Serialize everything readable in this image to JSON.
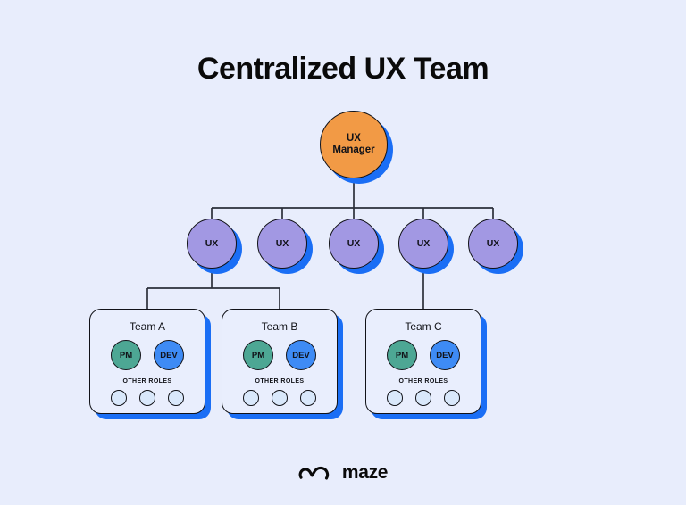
{
  "page": {
    "title": "Centralized UX Team",
    "background_color": "#e8edfc"
  },
  "colors": {
    "manager_fill": "#f29a45",
    "ux_fill": "#a298e3",
    "shadow": "#1a6ef5",
    "pm_fill": "#4da794",
    "dev_fill": "#3e8bf5",
    "other_dot_fill": "#d9e8fb",
    "card_fill": "#e9eefd",
    "stroke": "#111218"
  },
  "org_chart": {
    "manager": {
      "label_line1": "UX",
      "label_line2": "Manager"
    },
    "ux_nodes": [
      {
        "label": "UX"
      },
      {
        "label": "UX"
      },
      {
        "label": "UX"
      },
      {
        "label": "UX"
      },
      {
        "label": "UX"
      }
    ],
    "teams": [
      {
        "name": "Team A",
        "roles": [
          {
            "label": "PM"
          },
          {
            "label": "DEV"
          }
        ],
        "other_roles_label": "OTHER ROLES",
        "other_roles_count": 3
      },
      {
        "name": "Team B",
        "roles": [
          {
            "label": "PM"
          },
          {
            "label": "DEV"
          }
        ],
        "other_roles_label": "OTHER ROLES",
        "other_roles_count": 3
      },
      {
        "name": "Team C",
        "roles": [
          {
            "label": "PM"
          },
          {
            "label": "DEV"
          }
        ],
        "other_roles_label": "OTHER ROLES",
        "other_roles_count": 3
      }
    ]
  },
  "footer": {
    "logo_mark": "maze-wave-icon",
    "brand": "maze"
  }
}
